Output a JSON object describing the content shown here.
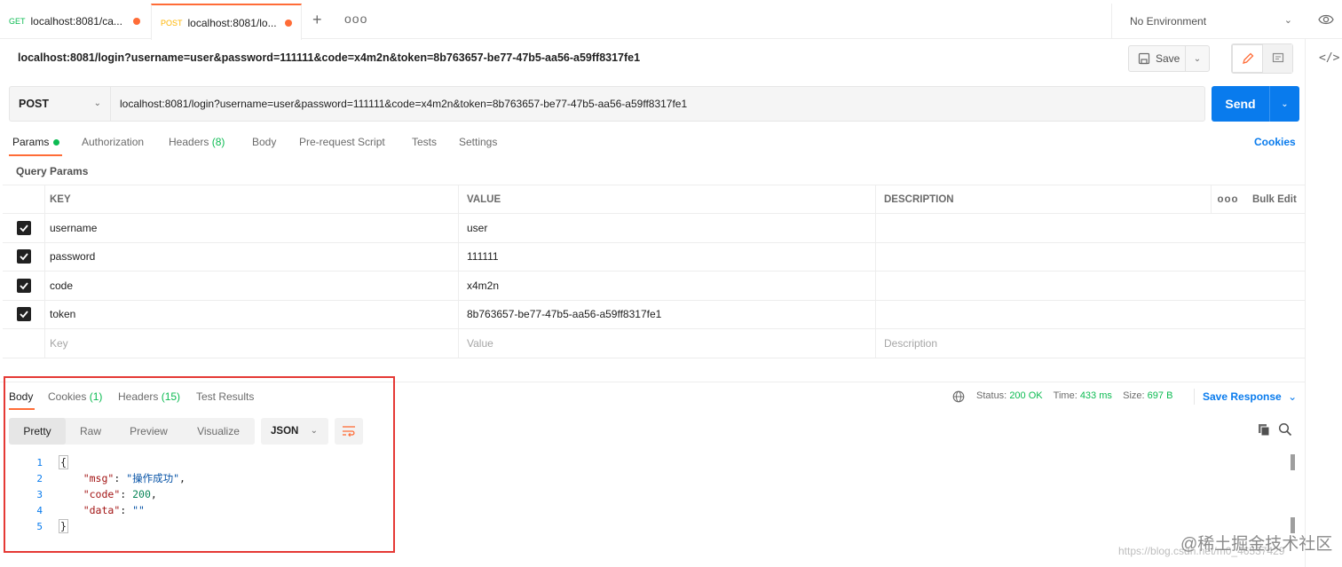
{
  "tabs": [
    {
      "method": "GET",
      "label": "localhost:8081/ca..."
    },
    {
      "method": "POST",
      "label": "localhost:8081/lo..."
    }
  ],
  "tabbar": {
    "plus": "+",
    "more": "ooo"
  },
  "environment": {
    "label": "No Environment"
  },
  "request": {
    "title": "localhost:8081/login?username=user&password=111111&code=x4m2n&token=8b763657-be77-47b5-aa56-a59ff8317fe1",
    "save_label": "Save",
    "method": "POST",
    "url": "localhost:8081/login?username=user&password=111111&code=x4m2n&token=8b763657-be77-47b5-aa56-a59ff8317fe1",
    "send_label": "Send"
  },
  "request_tabs": {
    "params": "Params",
    "authorization": "Authorization",
    "headers": "Headers",
    "headers_count": "(8)",
    "body": "Body",
    "prerequest": "Pre-request Script",
    "tests": "Tests",
    "settings": "Settings",
    "cookies": "Cookies"
  },
  "query_params": {
    "label": "Query Params",
    "headers": {
      "key": "KEY",
      "value": "VALUE",
      "description": "DESCRIPTION",
      "more": "ooo",
      "bulk_edit": "Bulk Edit"
    },
    "rows": [
      {
        "key": "username",
        "value": "user"
      },
      {
        "key": "password",
        "value": "111111"
      },
      {
        "key": "code",
        "value": "x4m2n"
      },
      {
        "key": "token",
        "value": "8b763657-be77-47b5-aa56-a59ff8317fe1"
      }
    ],
    "placeholders": {
      "key": "Key",
      "value": "Value",
      "description": "Description"
    }
  },
  "response": {
    "tabs": {
      "body": "Body",
      "cookies": "Cookies",
      "cookies_count": "(1)",
      "headers": "Headers",
      "headers_count": "(15)",
      "test_results": "Test Results"
    },
    "status_label": "Status:",
    "status_value": "200 OK",
    "time_label": "Time:",
    "time_value": "433 ms",
    "size_label": "Size:",
    "size_value": "697 B",
    "save_response": "Save Response",
    "views": [
      "Pretty",
      "Raw",
      "Preview",
      "Visualize"
    ],
    "format": "JSON",
    "lines": {
      "n1": "1",
      "n2": "2",
      "n3": "3",
      "n4": "4",
      "n5": "5",
      "open": "{",
      "msg_key": "\"msg\"",
      "msg_val": "\"操作成功\"",
      "code_key": "\"code\"",
      "code_val": "200",
      "data_key": "\"data\"",
      "data_val": "\"\"",
      "close": "}"
    }
  },
  "watermark": {
    "main": "@稀土掘金技术社区",
    "sub": "https://blog.csdn.net/m0_46537429"
  },
  "colors": {
    "accent": "#ff6c37",
    "primary": "#097bed",
    "success": "#0cbb52",
    "highlight": "#e53935"
  }
}
